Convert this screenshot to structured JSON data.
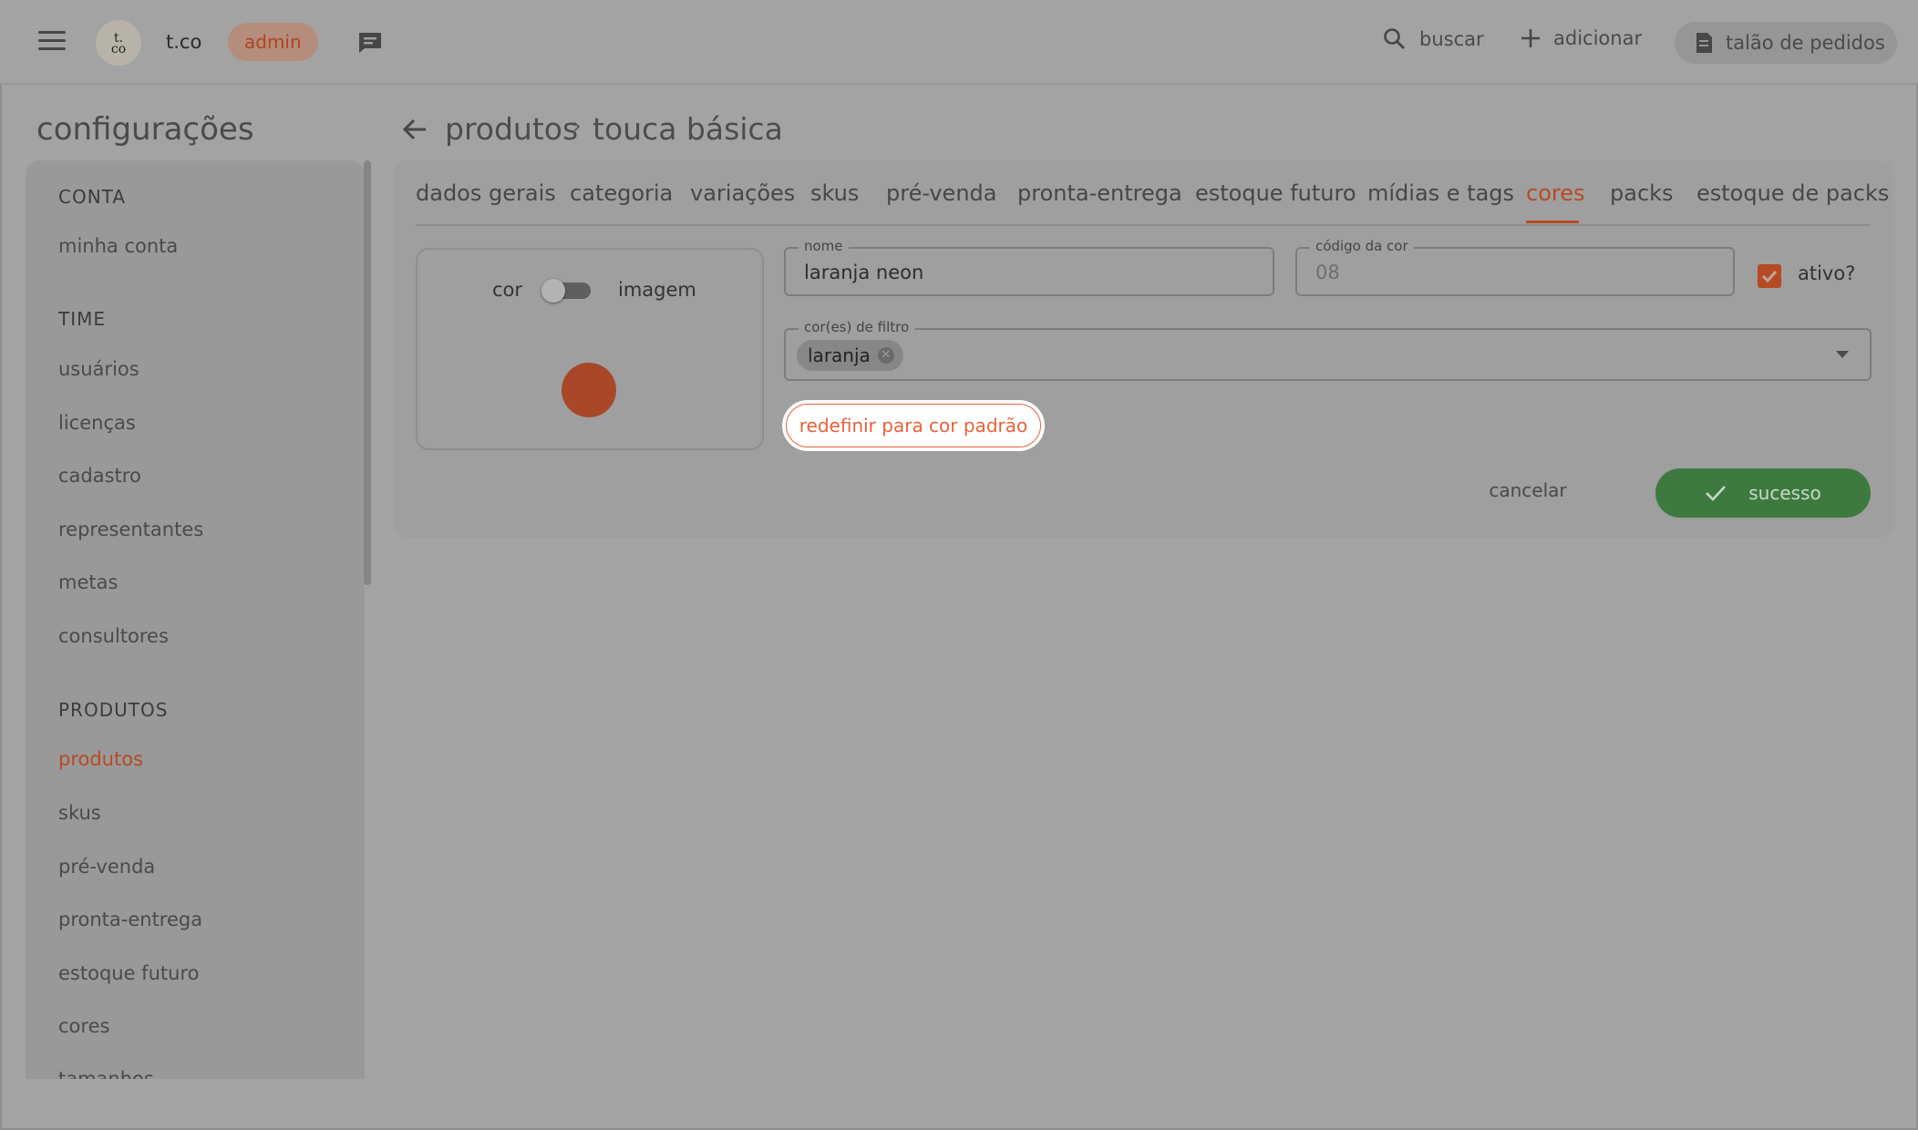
{
  "header": {
    "avatar_text": "t.\nco",
    "company": "t.co",
    "role_badge": "admin",
    "search_label": "buscar",
    "add_label": "adicionar",
    "orders_label": "talão de pedidos"
  },
  "sidebar": {
    "title": "configurações",
    "sections": [
      {
        "label": "CONTA",
        "items": [
          {
            "label": "minha conta"
          }
        ]
      },
      {
        "label": "TIME",
        "items": [
          {
            "label": "usuários"
          },
          {
            "label": "licenças"
          },
          {
            "label": "cadastro"
          },
          {
            "label": "representantes"
          },
          {
            "label": "metas"
          },
          {
            "label": "consultores"
          }
        ]
      },
      {
        "label": "PRODUTOS",
        "items": [
          {
            "label": "produtos",
            "active": true
          },
          {
            "label": "skus"
          },
          {
            "label": "pré-venda"
          },
          {
            "label": "pronta-entrega"
          },
          {
            "label": "estoque futuro"
          },
          {
            "label": "cores"
          },
          {
            "label": "tamanhos"
          }
        ]
      }
    ]
  },
  "breadcrumb": {
    "parent": "produtos",
    "separator": "›",
    "current": "touca básica"
  },
  "tabs": [
    {
      "label": "dados gerais"
    },
    {
      "label": "categoria"
    },
    {
      "label": "variações"
    },
    {
      "label": "skus"
    },
    {
      "label": "pré-venda"
    },
    {
      "label": "pronta-entrega"
    },
    {
      "label": "estoque futuro"
    },
    {
      "label": "mídias e tags"
    },
    {
      "label": "cores",
      "active": true
    },
    {
      "label": "packs"
    },
    {
      "label": "estoque de packs"
    }
  ],
  "form": {
    "toggle_left_label": "cor",
    "toggle_right_label": "imagem",
    "toggle_state": "cor",
    "swatch_color": "#a94828",
    "name_label": "nome",
    "name_value": "laranja neon",
    "code_label": "código da cor",
    "code_placeholder": "08",
    "active_label": "ativo?",
    "active_checked": true,
    "filter_label": "cor(es) de filtro",
    "filter_chips": [
      "laranja"
    ],
    "reset_button": "redefinir para cor padrão",
    "cancel_button": "cancelar",
    "success_button": "sucesso"
  },
  "colors": {
    "accent": "#b64a24",
    "reset_accent": "#e8623a",
    "success": "#3e7a40"
  }
}
